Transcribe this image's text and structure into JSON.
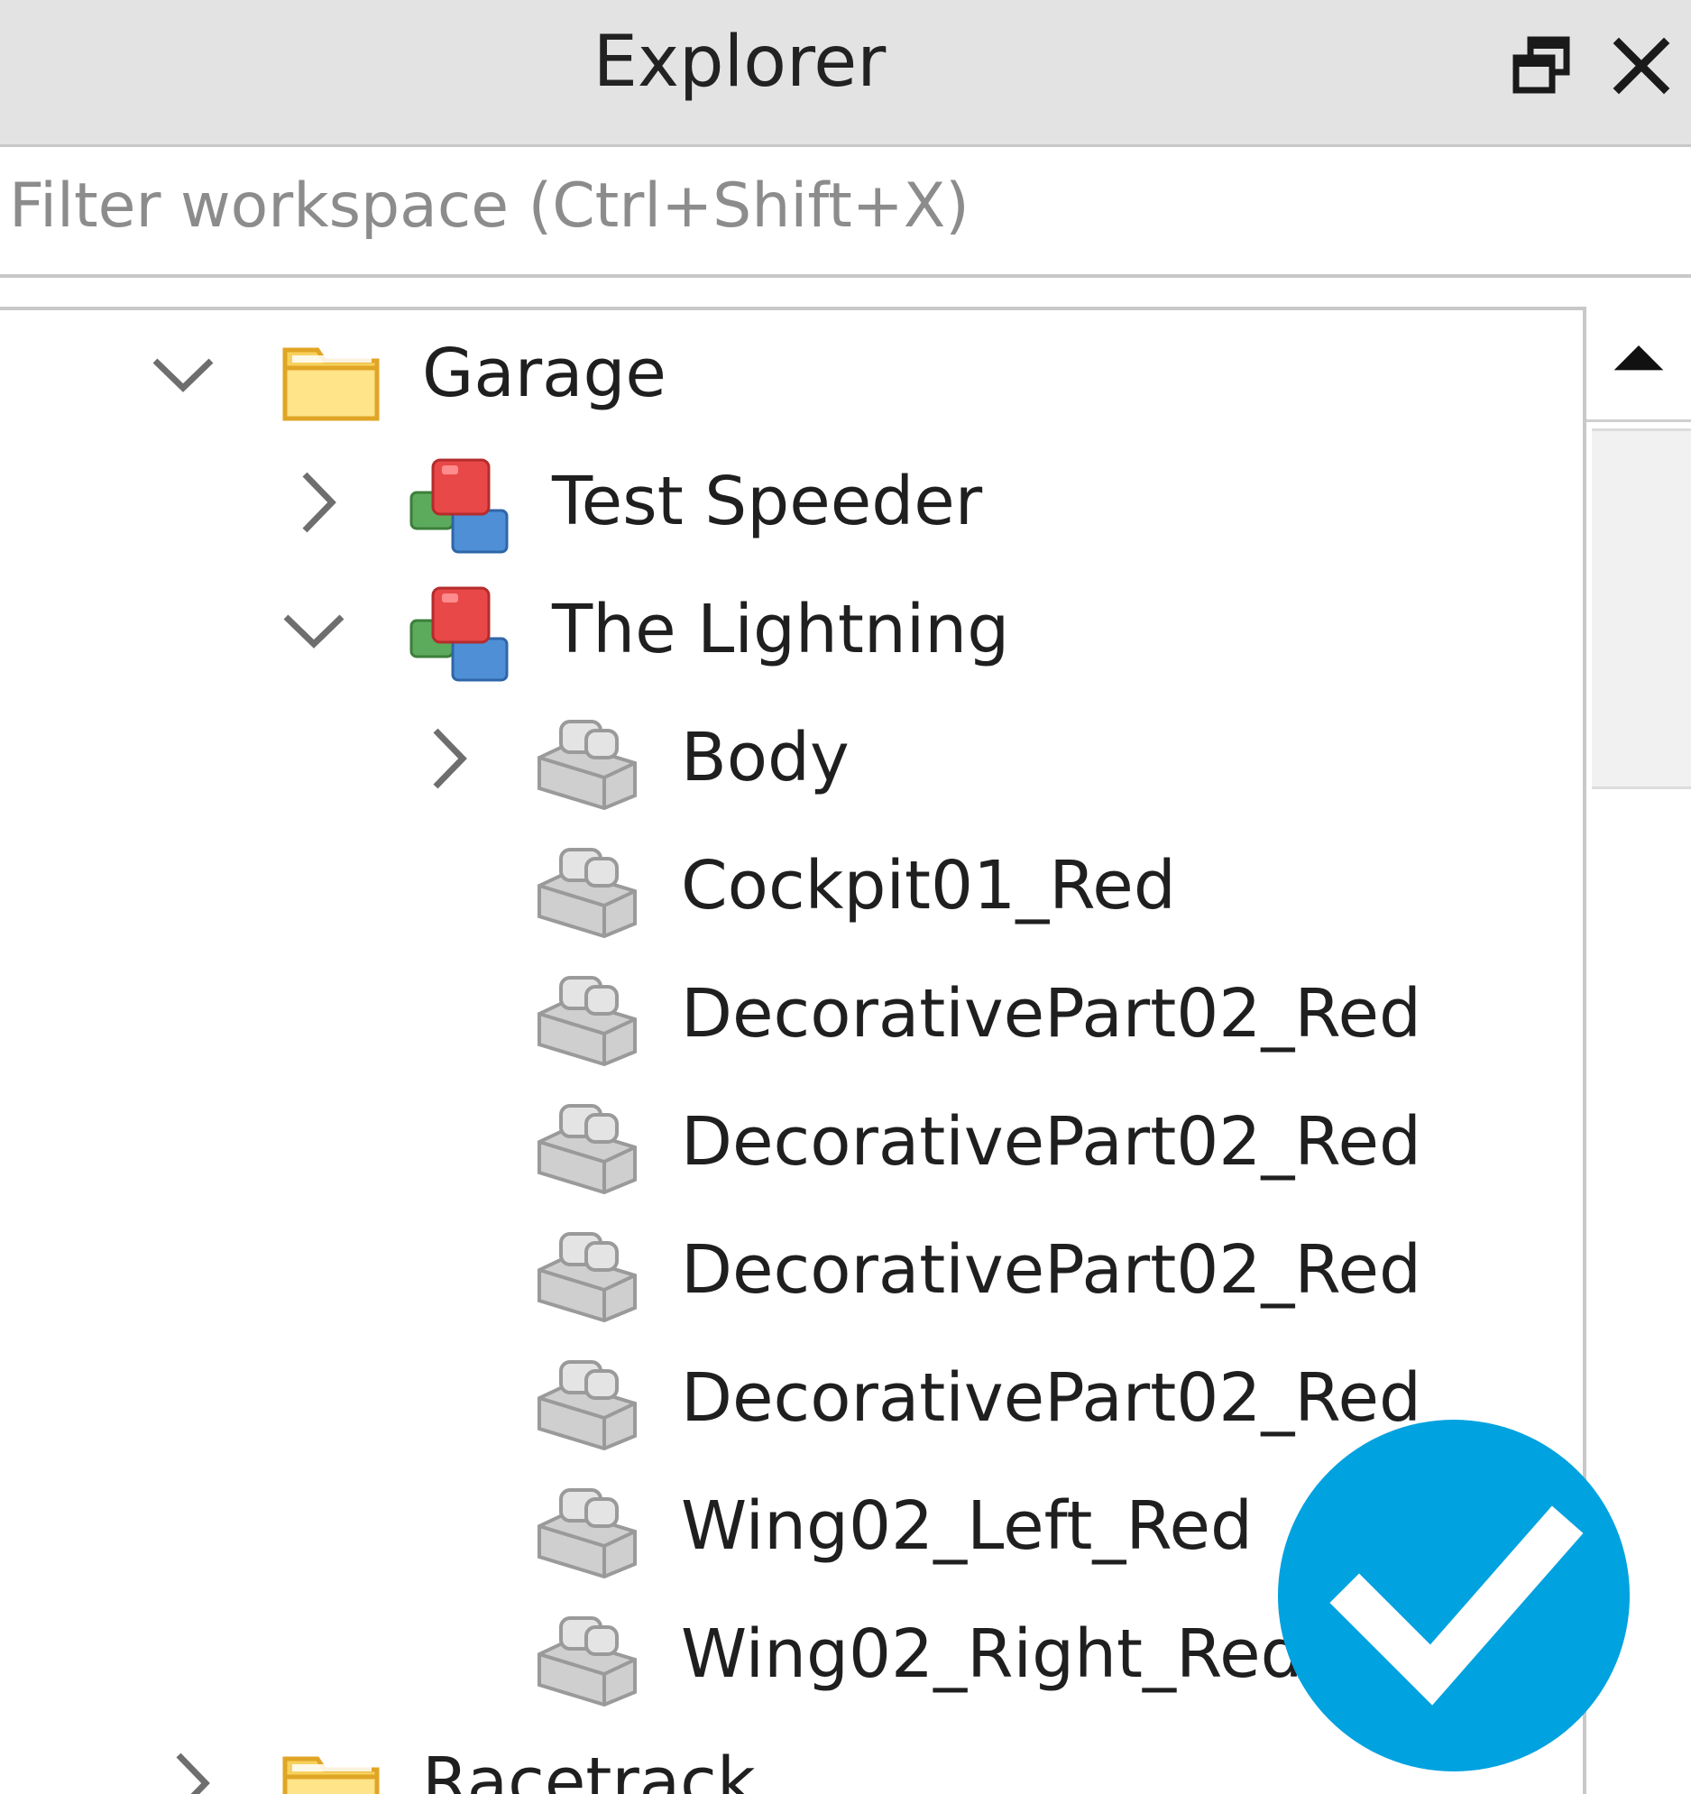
{
  "window": {
    "title": "Explorer"
  },
  "filter": {
    "placeholder": "Filter workspace (Ctrl+Shift+X)",
    "value": ""
  },
  "tree": {
    "items": [
      {
        "label": "Garage",
        "icon": "folder-icon",
        "expander": "expanded",
        "depth": 0
      },
      {
        "label": "Test Speeder",
        "icon": "model-icon",
        "expander": "collapsed",
        "depth": 1
      },
      {
        "label": "The Lightning",
        "icon": "model-icon",
        "expander": "expanded",
        "depth": 1
      },
      {
        "label": "Body",
        "icon": "part-icon",
        "expander": "collapsed",
        "depth": 2
      },
      {
        "label": "Cockpit01_Red",
        "icon": "part-icon",
        "expander": "none",
        "depth": 2
      },
      {
        "label": "DecorativePart02_Red",
        "icon": "part-icon",
        "expander": "none",
        "depth": 2
      },
      {
        "label": "DecorativePart02_Red",
        "icon": "part-icon",
        "expander": "none",
        "depth": 2
      },
      {
        "label": "DecorativePart02_Red",
        "icon": "part-icon",
        "expander": "none",
        "depth": 2
      },
      {
        "label": "DecorativePart02_Red",
        "icon": "part-icon",
        "expander": "none",
        "depth": 2
      },
      {
        "label": "Wing02_Left_Red",
        "icon": "part-icon",
        "expander": "none",
        "depth": 2
      },
      {
        "label": "Wing02_Right_Red",
        "icon": "part-icon",
        "expander": "none",
        "depth": 2
      },
      {
        "label": "Racetrack",
        "icon": "folder-icon",
        "expander": "collapsed",
        "depth": 0
      }
    ]
  },
  "badge": {
    "icon": "checkmark-icon",
    "color": "#00a2e0"
  },
  "colors": {
    "titlebar_bg": "#e3e3e3",
    "folder_yellow": "#f7d15c",
    "check_blue": "#00a2e0"
  }
}
